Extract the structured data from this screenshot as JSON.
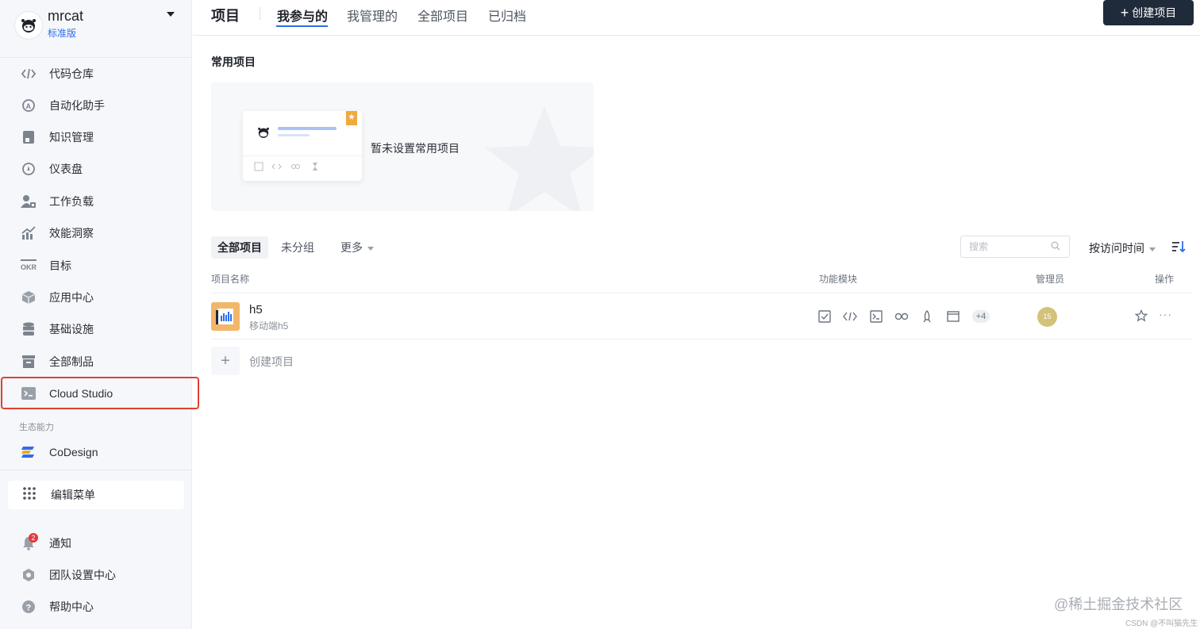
{
  "team": {
    "name": "mrcat",
    "plan": "标准版"
  },
  "sidebar": {
    "items": [
      {
        "label": "代码仓库",
        "icon": "code-icon"
      },
      {
        "label": "自动化助手",
        "icon": "automation-icon"
      },
      {
        "label": "知识管理",
        "icon": "book-icon"
      },
      {
        "label": "仪表盘",
        "icon": "gauge-icon"
      },
      {
        "label": "工作负载",
        "icon": "workload-icon"
      },
      {
        "label": "效能洞察",
        "icon": "chart-icon"
      },
      {
        "label": "目标",
        "icon": "okr-icon"
      },
      {
        "label": "应用中心",
        "icon": "cube-icon"
      },
      {
        "label": "基础设施",
        "icon": "database-icon"
      },
      {
        "label": "全部制品",
        "icon": "archive-icon"
      },
      {
        "label": "Cloud Studio",
        "icon": "terminal-icon"
      }
    ],
    "section_label": "生态能力",
    "eco_item": {
      "label": "CoDesign",
      "icon": "codesign-icon"
    },
    "edit_menu": "编辑菜单",
    "bottom_items": [
      {
        "label": "通知",
        "icon": "bell-icon",
        "badge": "2"
      },
      {
        "label": "团队设置中心",
        "icon": "settings-icon"
      },
      {
        "label": "帮助中心",
        "icon": "help-icon"
      }
    ]
  },
  "header": {
    "title": "项目",
    "tabs": [
      "我参与的",
      "我管理的",
      "全部项目",
      "已归档"
    ],
    "active_tab": "我参与的",
    "create_button": "创建项目"
  },
  "favorites": {
    "title": "常用项目",
    "empty_text": "暂未设置常用项目"
  },
  "filters": {
    "items": [
      "全部项目",
      "未分组",
      "更多"
    ],
    "search_placeholder": "搜索",
    "sort_label": "按访问时间"
  },
  "table": {
    "columns": [
      "项目名称",
      "功能模块",
      "管理员",
      "操作"
    ],
    "rows": [
      {
        "name": "h5",
        "desc": "移动端h5",
        "modules_more": "+4",
        "admin": "15"
      }
    ],
    "create_label": "创建项目"
  },
  "watermark": {
    "line1": "@稀土掘金技术社区",
    "line2": "CSDN @不叫猫先生"
  },
  "colors": {
    "accent": "#2d6cf0",
    "highlight": "#e0412f",
    "primary_button": "#1f2a3a"
  }
}
